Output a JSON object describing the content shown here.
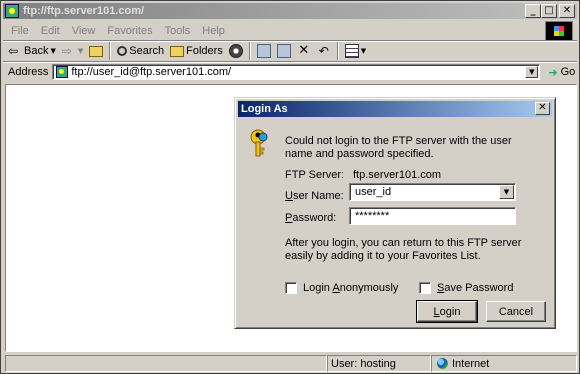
{
  "window": {
    "title": "ftp://ftp.server101.com/",
    "min_glyph": "_",
    "max_glyph": "□",
    "close_glyph": "✕"
  },
  "menu": [
    "File",
    "Edit",
    "View",
    "Favorites",
    "Tools",
    "Help"
  ],
  "toolbar": {
    "back_label": "Back",
    "search_label": "Search",
    "folders_label": "Folders"
  },
  "address": {
    "label": "Address",
    "value": "ftp://user_id@ftp.server101.com/",
    "go_label": "Go"
  },
  "status": {
    "user_text": "User: hosting",
    "zone_text": "Internet"
  },
  "dialog": {
    "title": "Login As",
    "message": "Could not login to the FTP server with the user name and password specified.",
    "server_label": "FTP Server:",
    "server_value": "ftp.server101.com",
    "username_label_pre": "",
    "username_label_u": "U",
    "username_label_post": "ser Name:",
    "username_value": "user_id",
    "password_label_u": "P",
    "password_label_post": "assword:",
    "password_value": "********",
    "info": "After you login, you can return to this FTP server easily by adding it to your Favorites List.",
    "anon_label_pre": "Login ",
    "anon_label_u": "A",
    "anon_label_post": "nonymously",
    "anon_checked": false,
    "save_label_u": "S",
    "save_label_post": "ave Password",
    "save_checked": false,
    "login_label_pre": "",
    "login_label_u": "L",
    "login_label_post": "ogin",
    "cancel_label": "Cancel",
    "close_glyph": "✕"
  }
}
